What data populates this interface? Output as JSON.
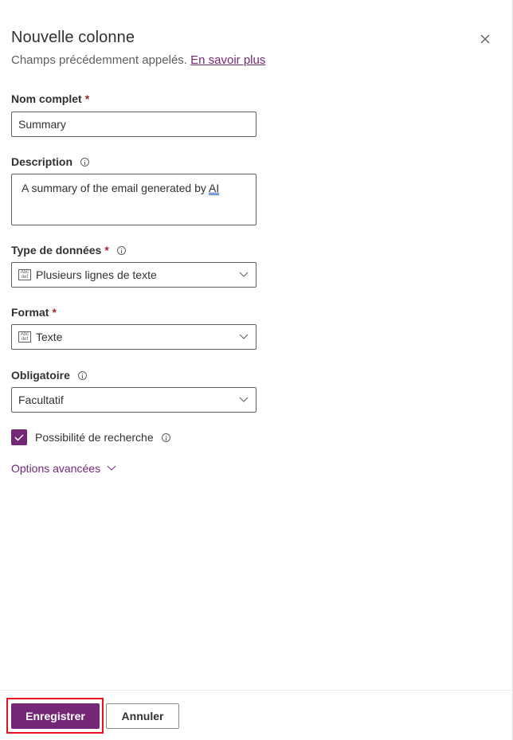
{
  "panel": {
    "title": "Nouvelle colonne",
    "subtitle": "Champs précédemment appelés.",
    "learn_more_link": "En savoir plus",
    "close_icon": "close-icon"
  },
  "fields": {
    "display_name": {
      "label": "Nom complet",
      "required_mark": "*",
      "value": "Summary"
    },
    "description": {
      "label": "Description",
      "value_prefix": "A summary of the email generated by ",
      "value_suffix": "AI"
    },
    "data_type": {
      "label": "Type de données",
      "required_mark": "*",
      "icon_top": "Abc",
      "icon_bottom": "def",
      "value": "Plusieurs lignes de texte"
    },
    "format": {
      "label": "Format",
      "required_mark": "*",
      "icon_top": "Abc",
      "icon_bottom": "def",
      "value": "Texte"
    },
    "required": {
      "label": "Obligatoire",
      "value": "Facultatif"
    },
    "searchable": {
      "label": "Possibilité de recherche",
      "checked": true
    },
    "advanced_options": {
      "label": "Options avancées"
    }
  },
  "footer": {
    "save_label": "Enregistrer",
    "cancel_label": "Annuler"
  },
  "colors": {
    "accent": "#742774",
    "required": "#a4262c",
    "highlight": "#e81123"
  }
}
